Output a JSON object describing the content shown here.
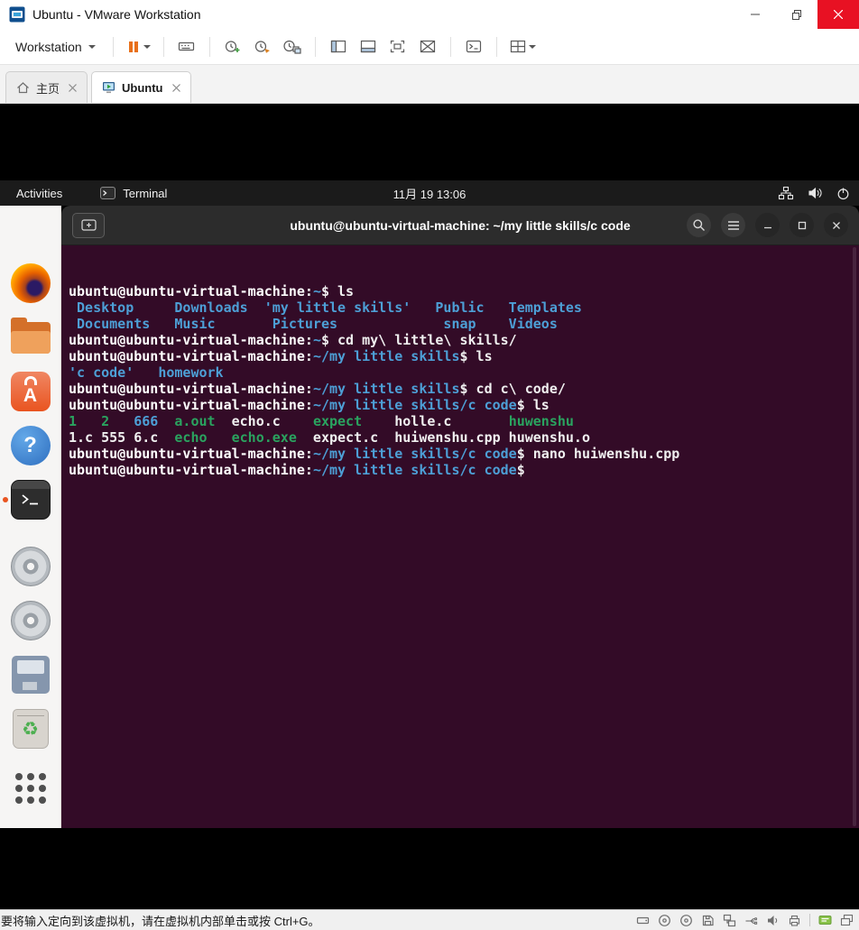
{
  "window": {
    "title": "Ubuntu - VMware Workstation"
  },
  "toolbar": {
    "workstation_label": "Workstation",
    "icon_names": [
      "pause-icon",
      "ctrl-alt-del-icon",
      "snapshot-take-icon",
      "snapshot-revert-icon",
      "snapshot-manager-icon",
      "library-panel-icon",
      "thumbnail-bar-icon",
      "fullscreen-icon",
      "unity-icon",
      "console-view-icon",
      "capture-icon"
    ]
  },
  "tabs": {
    "home": {
      "label": "主页"
    },
    "ubuntu": {
      "label": "Ubuntu"
    }
  },
  "ubuntu_screen": {
    "topbar": {
      "activities_label": "Activities",
      "app_label": "Terminal",
      "clock": "11月 19 13:06",
      "icon_names": [
        "tree-icon",
        "volume-icon",
        "power-icon"
      ]
    },
    "dock": {
      "software_letter": "A",
      "help_glyph": "?",
      "trash_glyph": "♻",
      "items": [
        "firefox",
        "files",
        "ubuntu-software",
        "help",
        "terminal",
        "optical-disc-1",
        "optical-disc-2",
        "floppy-drive",
        "trash",
        "app-grid"
      ]
    },
    "terminal": {
      "title": "ubuntu@ubuntu-virtual-machine: ~/my little skills/c code",
      "colors": {
        "background": "#330b27",
        "prompt_user": "#ffffff",
        "path_and_dirs": "#4d9fd6",
        "executables": "#2aa35f",
        "text": "#f0f0f0"
      },
      "lines": [
        [
          {
            "c": "u",
            "t": "ubuntu@ubuntu-virtual-machine"
          },
          {
            "c": "w",
            "t": ":"
          },
          {
            "c": "b",
            "t": "~"
          },
          {
            "c": "w",
            "t": "$ ls"
          }
        ],
        [
          {
            "c": "b",
            "t": " Desktop     Downloads  'my little skills'   Public   Templates"
          }
        ],
        [
          {
            "c": "b",
            "t": " Documents   Music       Pictures             snap    Videos"
          }
        ],
        [
          {
            "c": "u",
            "t": "ubuntu@ubuntu-virtual-machine"
          },
          {
            "c": "w",
            "t": ":"
          },
          {
            "c": "b",
            "t": "~"
          },
          {
            "c": "w",
            "t": "$ cd my\\ little\\ skills/"
          }
        ],
        [
          {
            "c": "u",
            "t": "ubuntu@ubuntu-virtual-machine"
          },
          {
            "c": "w",
            "t": ":"
          },
          {
            "c": "b",
            "t": "~/my little skills"
          },
          {
            "c": "w",
            "t": "$ ls"
          }
        ],
        [
          {
            "c": "b",
            "t": "'c code'   homework"
          }
        ],
        [
          {
            "c": "u",
            "t": "ubuntu@ubuntu-virtual-machine"
          },
          {
            "c": "w",
            "t": ":"
          },
          {
            "c": "b",
            "t": "~/my little skills"
          },
          {
            "c": "w",
            "t": "$ cd c\\ code/"
          }
        ],
        [
          {
            "c": "u",
            "t": "ubuntu@ubuntu-virtual-machine"
          },
          {
            "c": "w",
            "t": ":"
          },
          {
            "c": "b",
            "t": "~/my little skills/c code"
          },
          {
            "c": "w",
            "t": "$ ls"
          }
        ],
        [
          {
            "c": "g",
            "t": "1"
          },
          {
            "c": "w",
            "t": "   "
          },
          {
            "c": "g",
            "t": "2"
          },
          {
            "c": "w",
            "t": "   "
          },
          {
            "c": "b",
            "t": "666"
          },
          {
            "c": "w",
            "t": "  "
          },
          {
            "c": "g",
            "t": "a.out"
          },
          {
            "c": "w",
            "t": "  echo.c    "
          },
          {
            "c": "g",
            "t": "expect"
          },
          {
            "c": "w",
            "t": "    holle.c       "
          },
          {
            "c": "g",
            "t": "huwenshu"
          }
        ],
        [
          {
            "c": "w",
            "t": "1.c 555 6.c  "
          },
          {
            "c": "g",
            "t": "echo"
          },
          {
            "c": "w",
            "t": "   "
          },
          {
            "c": "g",
            "t": "echo.exe"
          },
          {
            "c": "w",
            "t": "  expect.c  huiwenshu.cpp huwenshu.o"
          }
        ],
        [
          {
            "c": "u",
            "t": "ubuntu@ubuntu-virtual-machine"
          },
          {
            "c": "w",
            "t": ":"
          },
          {
            "c": "b",
            "t": "~/my little skills/c code"
          },
          {
            "c": "w",
            "t": "$ nano huiwenshu.cpp"
          }
        ],
        [
          {
            "c": "u",
            "t": "ubuntu@ubuntu-virtual-machine"
          },
          {
            "c": "w",
            "t": ":"
          },
          {
            "c": "b",
            "t": "~/my little skills/c code"
          },
          {
            "c": "w",
            "t": "$ "
          }
        ]
      ]
    }
  },
  "statusbar": {
    "message": "要将输入定向到该虚拟机，请在虚拟机内部单击或按 Ctrl+G。",
    "icon_names": [
      "hdd-icon",
      "cdrom-icon",
      "cdrom2-icon",
      "floppy-icon",
      "network-icon",
      "usb-icon",
      "sound-icon",
      "printer-icon",
      "message-icon",
      "restore-screen-icon"
    ]
  }
}
